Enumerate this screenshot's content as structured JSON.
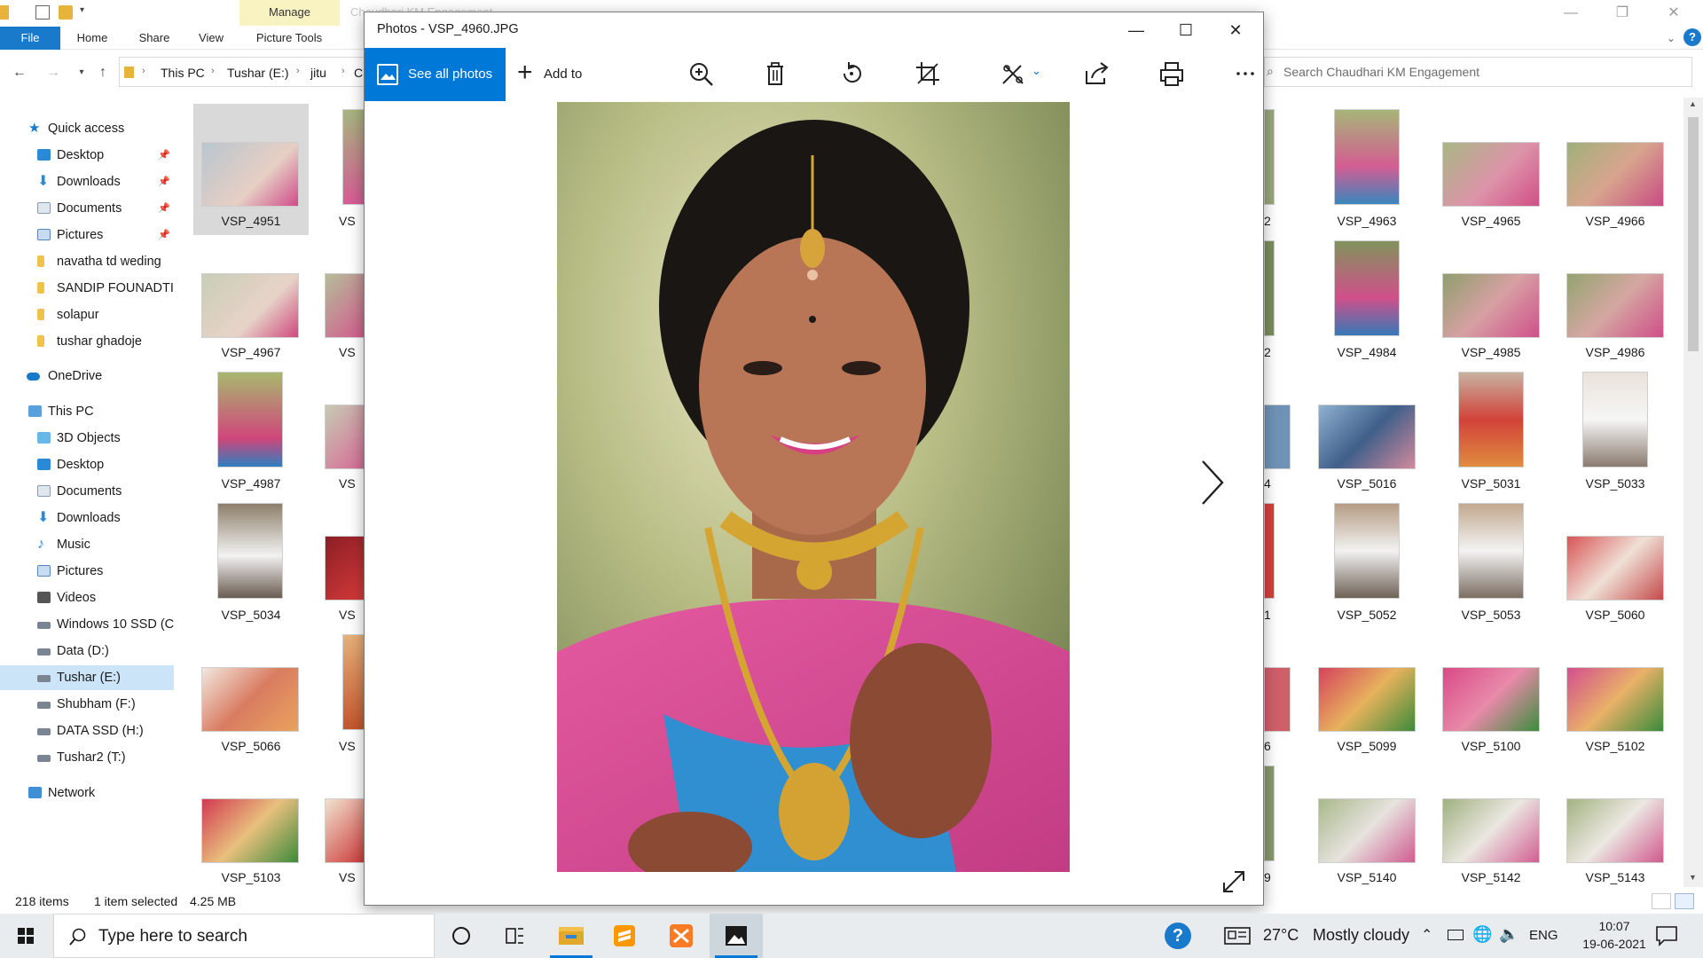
{
  "explorer": {
    "title": "Chaudhari KM Engagement",
    "context_tab": "Manage",
    "ribbon_tabs": [
      "File",
      "Home",
      "Share",
      "View",
      "Picture Tools"
    ],
    "breadcrumb": [
      "This PC",
      "Tushar (E:)",
      "jitu",
      "C"
    ],
    "search_placeholder": "Search Chaudhari KM Engagement",
    "nav": {
      "quick_access": "Quick access",
      "quick_items": [
        {
          "label": "Desktop",
          "pinned": true,
          "icon": "desktop-icon"
        },
        {
          "label": "Downloads",
          "pinned": true,
          "icon": "downloads-icon"
        },
        {
          "label": "Documents",
          "pinned": true,
          "icon": "documents-icon"
        },
        {
          "label": "Pictures",
          "pinned": true,
          "icon": "pictures-icon"
        },
        {
          "label": "navatha td weding",
          "pinned": false,
          "icon": "folder-icon"
        },
        {
          "label": "SANDIP FOUNADTI(",
          "pinned": false,
          "icon": "folder-icon"
        },
        {
          "label": "solapur",
          "pinned": false,
          "icon": "folder-icon"
        },
        {
          "label": "tushar ghadoje",
          "pinned": false,
          "icon": "folder-icon"
        }
      ],
      "onedrive": "OneDrive",
      "this_pc": "This PC",
      "pc_items": [
        {
          "label": "3D Objects",
          "icon": "3d-objects-icon"
        },
        {
          "label": "Desktop",
          "icon": "desktop-icon"
        },
        {
          "label": "Documents",
          "icon": "documents-icon"
        },
        {
          "label": "Downloads",
          "icon": "downloads-icon"
        },
        {
          "label": "Music",
          "icon": "music-icon"
        },
        {
          "label": "Pictures",
          "icon": "pictures-icon"
        },
        {
          "label": "Videos",
          "icon": "videos-icon"
        },
        {
          "label": "Windows 10 SSD (C",
          "icon": "drive-icon"
        },
        {
          "label": "Data (D:)",
          "icon": "drive-icon"
        },
        {
          "label": "Tushar (E:)",
          "icon": "drive-icon",
          "selected": true
        },
        {
          "label": "Shubham (F:)",
          "icon": "drive-icon"
        },
        {
          "label": "DATA SSD (H:)",
          "icon": "drive-icon"
        },
        {
          "label": "Tushar2 (T:)",
          "icon": "drive-icon"
        }
      ],
      "network": "Network"
    },
    "files_left": [
      [
        "VSP_4951",
        "VS"
      ],
      [
        "VSP_4967",
        "VS"
      ],
      [
        "VSP_4987",
        "VS"
      ],
      [
        "VSP_5034",
        "VS"
      ],
      [
        "VSP_5066",
        "VS"
      ],
      [
        "VSP_5103",
        "VS"
      ]
    ],
    "files_right_partial": [
      "2",
      "2",
      "4",
      "1",
      "6",
      "9"
    ],
    "files_right": [
      [
        "VSP_4963",
        "VSP_4965",
        "VSP_4966"
      ],
      [
        "VSP_4984",
        "VSP_4985",
        "VSP_4986"
      ],
      [
        "VSP_5016",
        "VSP_5031",
        "VSP_5033"
      ],
      [
        "VSP_5052",
        "VSP_5053",
        "VSP_5060"
      ],
      [
        "VSP_5099",
        "VSP_5100",
        "VSP_5102"
      ],
      [
        "VSP_5140",
        "VSP_5142",
        "VSP_5143"
      ]
    ],
    "status": {
      "item_count": "218 items",
      "selection": "1 item selected",
      "size": "4.25 MB"
    }
  },
  "photos": {
    "title": "Photos - VSP_4960.JPG",
    "see_all": "See all photos",
    "add_to": "Add to",
    "toolbar_icons": [
      "zoom-icon",
      "delete-icon",
      "rotate-icon",
      "crop-icon",
      "edit-icon",
      "share-icon",
      "print-icon",
      "more-icon"
    ]
  },
  "taskbar": {
    "search_placeholder": "Type here to search",
    "weather_temp": "27°C",
    "weather_desc": "Mostly cloudy",
    "language": "ENG",
    "time": "10:07",
    "date": "19-06-2021"
  },
  "colors": {
    "accent": "#0078d7",
    "ribbon_file": "#1979ca",
    "manage_tab": "#f9f3c1",
    "selection": "#cce4f7"
  }
}
